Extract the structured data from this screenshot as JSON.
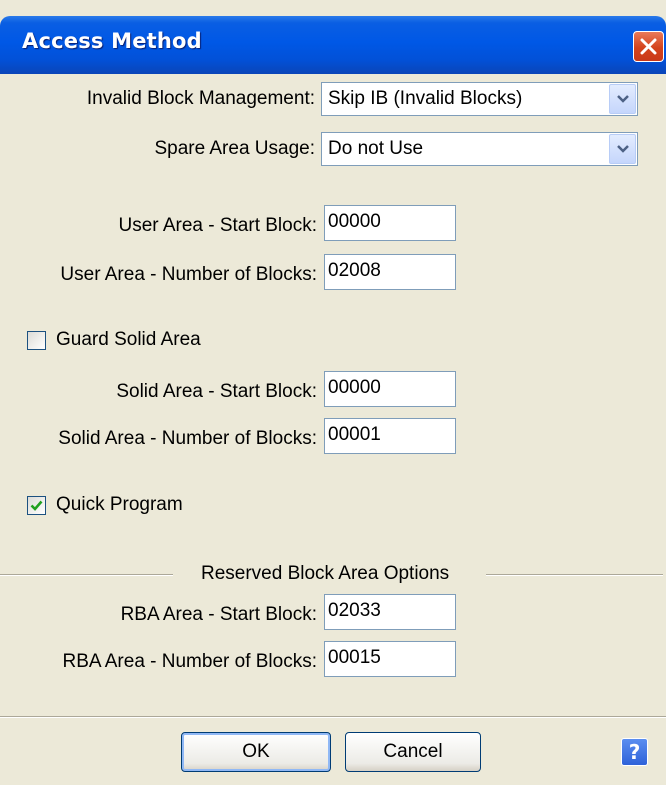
{
  "window": {
    "title": "Access Method"
  },
  "invalid_block_management": {
    "label": "Invalid Block Management:",
    "value": "Skip IB (Invalid Blocks)"
  },
  "spare_area_usage": {
    "label": "Spare Area Usage:",
    "value": "Do not Use"
  },
  "user_area_start": {
    "label": "User Area - Start Block:",
    "value": "00000"
  },
  "user_area_count": {
    "label": "User Area - Number of Blocks:",
    "value": "02008"
  },
  "guard_solid_area": {
    "label": "Guard Solid Area",
    "checked": false
  },
  "solid_area_start": {
    "label": "Solid Area - Start Block:",
    "value": "00000"
  },
  "solid_area_count": {
    "label": "Solid Area - Number of Blocks:",
    "value": "00001"
  },
  "quick_program": {
    "label": "Quick Program",
    "checked": true
  },
  "reserved_block_group": {
    "label": "Reserved Block Area Options"
  },
  "rba_start": {
    "label": "RBA Area - Start Block:",
    "value": "02033"
  },
  "rba_count": {
    "label": "RBA Area - Number of Blocks:",
    "value": "00015"
  },
  "buttons": {
    "ok": "OK",
    "cancel": "Cancel",
    "help": "?"
  },
  "colors": {
    "titlebar": "#0058e6",
    "dialog_bg": "#ece9d8",
    "close_button": "#d4431c",
    "checkmark": "#21a121"
  }
}
